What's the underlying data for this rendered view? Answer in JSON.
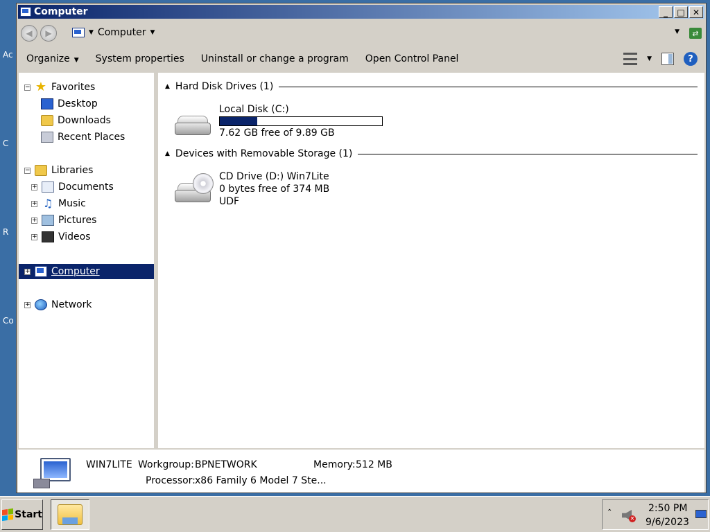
{
  "desktop": {
    "labels": [
      "Ac",
      "C",
      "R",
      "Co"
    ]
  },
  "window": {
    "title": "Computer",
    "controls": {
      "minimize": "_",
      "maximize": "□",
      "close": "✕"
    }
  },
  "address": {
    "location": "Computer"
  },
  "toolbar": {
    "organize": "Organize",
    "system_properties": "System properties",
    "uninstall": "Uninstall or change a program",
    "control_panel": "Open Control Panel",
    "help": "?"
  },
  "nav": {
    "favorites": "Favorites",
    "desktop": "Desktop",
    "downloads": "Downloads",
    "recent_places": "Recent Places",
    "libraries": "Libraries",
    "documents": "Documents",
    "music": "Music",
    "pictures": "Pictures",
    "videos": "Videos",
    "computer": "Computer",
    "network": "Network"
  },
  "content": {
    "hdd_group": "Hard Disk Drives (1)",
    "removable_group": "Devices with Removable Storage (1)",
    "local_disk": {
      "name": "Local Disk (C:)",
      "free": "7.62 GB free of 9.89 GB",
      "used_fraction": 0.23
    },
    "cd_drive": {
      "name": "CD Drive (D:) Win7Lite",
      "free": "0 bytes free of 374 MB",
      "fs": "UDF"
    }
  },
  "details": {
    "computer_name": "WIN7LITE",
    "workgroup_label": "Workgroup:",
    "workgroup": "BPNETWORK",
    "memory_label": "Memory:",
    "memory": "512 MB",
    "processor_label": "Processor:",
    "processor": "x86 Family 6 Model 7 Ste..."
  },
  "taskbar": {
    "start": "Start",
    "time": "2:50 PM",
    "date": "9/6/2023"
  }
}
